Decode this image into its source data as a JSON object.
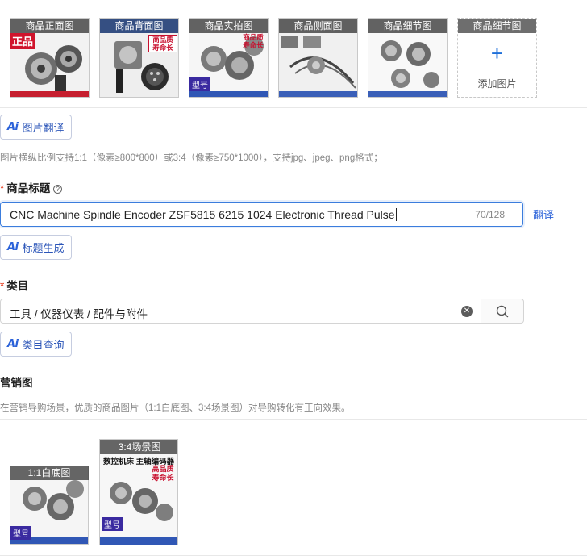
{
  "product_images": {
    "items": [
      {
        "caption": "商品正面图",
        "overlay_text": "正品"
      },
      {
        "caption": "商品背面图",
        "overlay_text": "商品质 寿命长"
      },
      {
        "caption": "商品实拍图",
        "overlay_text": "商品质 寿命长",
        "badge": "型号"
      },
      {
        "caption": "商品侧面图"
      },
      {
        "caption": "商品细节图"
      }
    ],
    "add_slot": {
      "caption": "商品细节图",
      "label": "添加图片",
      "icon": "plus-icon"
    }
  },
  "image_translate_button": {
    "icon": "ai-icon",
    "label": "图片翻译"
  },
  "image_hint": "图片横纵比例支持1:1（像素≥800*800）或3:4（像素≥750*1000），支持jpg、jpeg、png格式；",
  "title_field": {
    "required_mark": "*",
    "label": "商品标题",
    "help_icon": "question-icon",
    "value": "CNC Machine Spindle Encoder ZSF5815 6215 1024 Electronic Thread Pulse",
    "counter": "70/128",
    "translate_link": "翻译"
  },
  "title_generate_button": {
    "icon": "ai-icon",
    "label": "标题生成"
  },
  "category_field": {
    "required_mark": "*",
    "label": "类目",
    "value": "工具 / 仪器仪表 / 配件与附件",
    "clear_icon": "close-circle-icon",
    "search_icon": "search-icon"
  },
  "category_query_button": {
    "icon": "ai-icon",
    "label": "类目查询"
  },
  "marketing": {
    "label": "营销图",
    "hint": "在营销导购场景，优质的商品图片（1:1白底图、3:4场景图）对导购转化有正向效果。",
    "images": [
      {
        "caption": "1:1白底图",
        "badge": "型号"
      },
      {
        "caption": "3:4场景图",
        "headline": "数控机床 主轴编码器",
        "overlay_text": "高品质 寿命长",
        "badge": "型号"
      }
    ]
  },
  "colors": {
    "accent": "#2b62d9",
    "required": "#e5391c",
    "input_focus": "#3b7ddd"
  }
}
